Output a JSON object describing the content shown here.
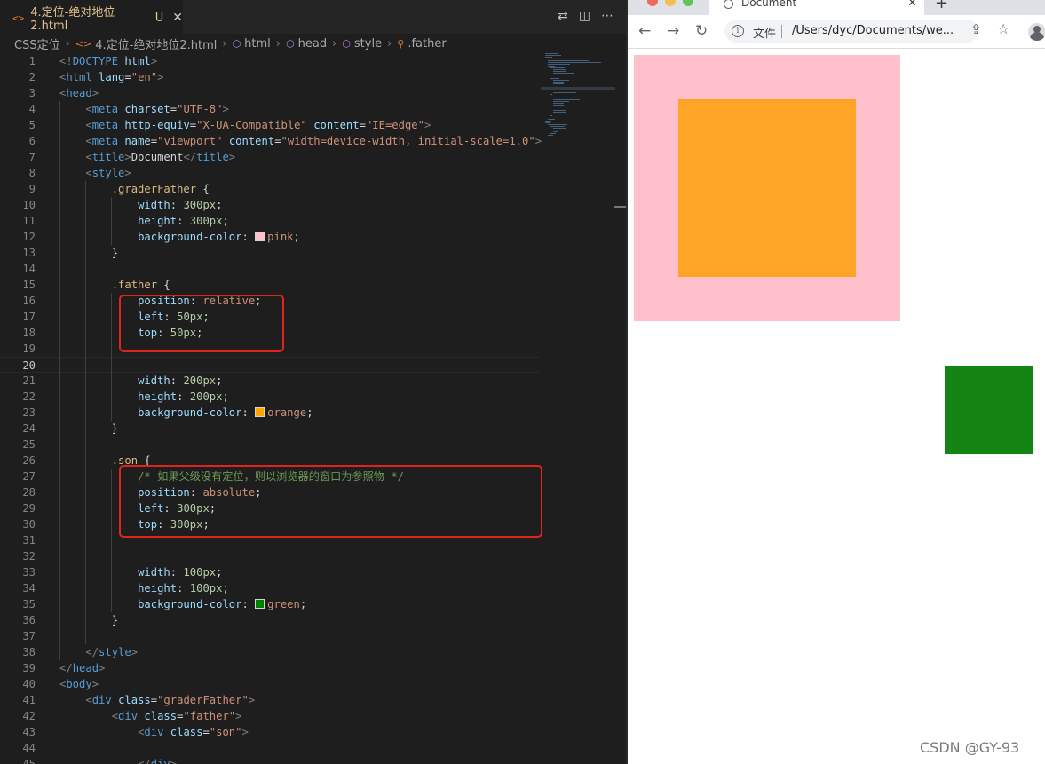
{
  "editor": {
    "tab": {
      "icon": "html-file-icon",
      "glyph": "<>",
      "label": "4.定位-绝对地位2.html",
      "status": "U"
    },
    "breadcrumb": {
      "folder": "CSS定位",
      "file": "4.定位-绝对地位2.html",
      "items": [
        "html",
        "head",
        "style",
        ".father"
      ]
    },
    "code_lines": [
      [
        [
          "t-br",
          "<!"
        ],
        [
          "t-tag",
          "DOCTYPE"
        ],
        [
          "t-txt",
          " "
        ],
        [
          "t-attr",
          "html"
        ],
        [
          "t-br",
          ">"
        ]
      ],
      [
        [
          "t-br",
          "<"
        ],
        [
          "t-tag",
          "html"
        ],
        [
          "t-txt",
          " "
        ],
        [
          "t-attr",
          "lang"
        ],
        [
          "t-txt",
          "="
        ],
        [
          "t-str",
          "\"en\""
        ],
        [
          "t-br",
          ">"
        ]
      ],
      [
        [
          "t-br",
          "<"
        ],
        [
          "t-tag",
          "head"
        ],
        [
          "t-br",
          ">"
        ]
      ],
      [
        [
          "t-txt",
          "    "
        ],
        [
          "t-br",
          "<"
        ],
        [
          "t-tag",
          "meta"
        ],
        [
          "t-txt",
          " "
        ],
        [
          "t-attr",
          "charset"
        ],
        [
          "t-txt",
          "="
        ],
        [
          "t-str",
          "\"UTF-8\""
        ],
        [
          "t-br",
          ">"
        ]
      ],
      [
        [
          "t-txt",
          "    "
        ],
        [
          "t-br",
          "<"
        ],
        [
          "t-tag",
          "meta"
        ],
        [
          "t-txt",
          " "
        ],
        [
          "t-attr",
          "http-equiv"
        ],
        [
          "t-txt",
          "="
        ],
        [
          "t-str",
          "\"X-UA-Compatible\""
        ],
        [
          "t-txt",
          " "
        ],
        [
          "t-attr",
          "content"
        ],
        [
          "t-txt",
          "="
        ],
        [
          "t-str",
          "\"IE=edge\""
        ],
        [
          "t-br",
          ">"
        ]
      ],
      [
        [
          "t-txt",
          "    "
        ],
        [
          "t-br",
          "<"
        ],
        [
          "t-tag",
          "meta"
        ],
        [
          "t-txt",
          " "
        ],
        [
          "t-attr",
          "name"
        ],
        [
          "t-txt",
          "="
        ],
        [
          "t-str",
          "\"viewport\""
        ],
        [
          "t-txt",
          " "
        ],
        [
          "t-attr",
          "content"
        ],
        [
          "t-txt",
          "="
        ],
        [
          "t-str",
          "\"width=device-width, initial-scale=1.0\""
        ],
        [
          "t-br",
          ">"
        ]
      ],
      [
        [
          "t-txt",
          "    "
        ],
        [
          "t-br",
          "<"
        ],
        [
          "t-tag",
          "title"
        ],
        [
          "t-br",
          ">"
        ],
        [
          "t-txt",
          "Document"
        ],
        [
          "t-br",
          "</"
        ],
        [
          "t-tag",
          "title"
        ],
        [
          "t-br",
          ">"
        ]
      ],
      [
        [
          "t-txt",
          "    "
        ],
        [
          "t-br",
          "<"
        ],
        [
          "t-tag",
          "style"
        ],
        [
          "t-br",
          ">"
        ]
      ],
      [
        [
          "t-txt",
          "        "
        ],
        [
          "t-sel",
          ".graderFather"
        ],
        [
          "t-txt",
          " {"
        ]
      ],
      [
        [
          "t-txt",
          "            "
        ],
        [
          "t-prop",
          "width"
        ],
        [
          "t-txt",
          ": "
        ],
        [
          "t-num",
          "300px"
        ],
        [
          "t-txt",
          ";"
        ]
      ],
      [
        [
          "t-txt",
          "            "
        ],
        [
          "t-prop",
          "height"
        ],
        [
          "t-txt",
          ": "
        ],
        [
          "t-num",
          "300px"
        ],
        [
          "t-txt",
          ";"
        ]
      ],
      [
        [
          "t-txt",
          "            "
        ],
        [
          "t-prop",
          "background-color"
        ],
        [
          "t-txt",
          ": "
        ],
        [
          "sw",
          "#ffc0cb"
        ],
        [
          "t-val",
          "pink"
        ],
        [
          "t-txt",
          ";"
        ]
      ],
      [
        [
          "t-txt",
          "        }"
        ]
      ],
      [],
      [
        [
          "t-txt",
          "        "
        ],
        [
          "t-sel",
          ".father"
        ],
        [
          "t-txt",
          " {"
        ]
      ],
      [
        [
          "t-txt",
          "            "
        ],
        [
          "t-prop",
          "position"
        ],
        [
          "t-txt",
          ": "
        ],
        [
          "t-val",
          "relative"
        ],
        [
          "t-txt",
          ";"
        ]
      ],
      [
        [
          "t-txt",
          "            "
        ],
        [
          "t-prop",
          "left"
        ],
        [
          "t-txt",
          ": "
        ],
        [
          "t-num",
          "50px"
        ],
        [
          "t-txt",
          ";"
        ]
      ],
      [
        [
          "t-txt",
          "            "
        ],
        [
          "t-prop",
          "top"
        ],
        [
          "t-txt",
          ": "
        ],
        [
          "t-num",
          "50px"
        ],
        [
          "t-txt",
          ";"
        ]
      ],
      [],
      [],
      [
        [
          "t-txt",
          "            "
        ],
        [
          "t-prop",
          "width"
        ],
        [
          "t-txt",
          ": "
        ],
        [
          "t-num",
          "200px"
        ],
        [
          "t-txt",
          ";"
        ]
      ],
      [
        [
          "t-txt",
          "            "
        ],
        [
          "t-prop",
          "height"
        ],
        [
          "t-txt",
          ": "
        ],
        [
          "t-num",
          "200px"
        ],
        [
          "t-txt",
          ";"
        ]
      ],
      [
        [
          "t-txt",
          "            "
        ],
        [
          "t-prop",
          "background-color"
        ],
        [
          "t-txt",
          ": "
        ],
        [
          "sw",
          "#ffa500"
        ],
        [
          "t-val",
          "orange"
        ],
        [
          "t-txt",
          ";"
        ]
      ],
      [
        [
          "t-txt",
          "        }"
        ]
      ],
      [],
      [
        [
          "t-txt",
          "        "
        ],
        [
          "t-sel",
          ".son"
        ],
        [
          "t-txt",
          " {"
        ]
      ],
      [
        [
          "t-txt",
          "            "
        ],
        [
          "t-com",
          "/* 如果父级没有定位，则以浏览器的窗口为参照物 */"
        ]
      ],
      [
        [
          "t-txt",
          "            "
        ],
        [
          "t-prop",
          "position"
        ],
        [
          "t-txt",
          ": "
        ],
        [
          "t-val",
          "absolute"
        ],
        [
          "t-txt",
          ";"
        ]
      ],
      [
        [
          "t-txt",
          "            "
        ],
        [
          "t-prop",
          "left"
        ],
        [
          "t-txt",
          ": "
        ],
        [
          "t-num",
          "300px"
        ],
        [
          "t-txt",
          ";"
        ]
      ],
      [
        [
          "t-txt",
          "            "
        ],
        [
          "t-prop",
          "top"
        ],
        [
          "t-txt",
          ": "
        ],
        [
          "t-num",
          "300px"
        ],
        [
          "t-txt",
          ";"
        ]
      ],
      [],
      [],
      [
        [
          "t-txt",
          "            "
        ],
        [
          "t-prop",
          "width"
        ],
        [
          "t-txt",
          ": "
        ],
        [
          "t-num",
          "100px"
        ],
        [
          "t-txt",
          ";"
        ]
      ],
      [
        [
          "t-txt",
          "            "
        ],
        [
          "t-prop",
          "height"
        ],
        [
          "t-txt",
          ": "
        ],
        [
          "t-num",
          "100px"
        ],
        [
          "t-txt",
          ";"
        ]
      ],
      [
        [
          "t-txt",
          "            "
        ],
        [
          "t-prop",
          "background-color"
        ],
        [
          "t-txt",
          ": "
        ],
        [
          "sw",
          "#008000"
        ],
        [
          "t-val",
          "green"
        ],
        [
          "t-txt",
          ";"
        ]
      ],
      [
        [
          "t-txt",
          "        }"
        ]
      ],
      [],
      [
        [
          "t-txt",
          "    "
        ],
        [
          "t-br",
          "</"
        ],
        [
          "t-tag",
          "style"
        ],
        [
          "t-br",
          ">"
        ]
      ],
      [
        [
          "t-br",
          "</"
        ],
        [
          "t-tag",
          "head"
        ],
        [
          "t-br",
          ">"
        ]
      ],
      [
        [
          "t-br",
          "<"
        ],
        [
          "t-tag",
          "body"
        ],
        [
          "t-br",
          ">"
        ]
      ],
      [
        [
          "t-txt",
          "    "
        ],
        [
          "t-br",
          "<"
        ],
        [
          "t-tag",
          "div"
        ],
        [
          "t-txt",
          " "
        ],
        [
          "t-attr",
          "class"
        ],
        [
          "t-txt",
          "="
        ],
        [
          "t-str",
          "\"graderFather\""
        ],
        [
          "t-br",
          ">"
        ]
      ],
      [
        [
          "t-txt",
          "        "
        ],
        [
          "t-br",
          "<"
        ],
        [
          "t-tag",
          "div"
        ],
        [
          "t-txt",
          " "
        ],
        [
          "t-attr",
          "class"
        ],
        [
          "t-txt",
          "="
        ],
        [
          "t-str",
          "\"father\""
        ],
        [
          "t-br",
          ">"
        ]
      ],
      [
        [
          "t-txt",
          "            "
        ],
        [
          "t-br",
          "<"
        ],
        [
          "t-tag",
          "div"
        ],
        [
          "t-txt",
          " "
        ],
        [
          "t-attr",
          "class"
        ],
        [
          "t-txt",
          "="
        ],
        [
          "t-str",
          "\"son\""
        ],
        [
          "t-br",
          ">"
        ]
      ],
      [],
      [
        [
          "t-txt",
          "            "
        ],
        [
          "t-br",
          "</"
        ],
        [
          "t-tag",
          "div"
        ],
        [
          "t-br",
          ">"
        ]
      ]
    ],
    "current_line": 20
  },
  "browser": {
    "tab_title": "Document",
    "new_tab_glyph": "+",
    "close_glyph": "✕",
    "url_scheme": "文件",
    "url": "/Users/dyc/Documents/we...",
    "info_glyph": "i",
    "colors": {
      "graderFather": "pink",
      "father": "#ffa427",
      "son": "#148414"
    }
  },
  "watermark": "CSDN @GY-93"
}
